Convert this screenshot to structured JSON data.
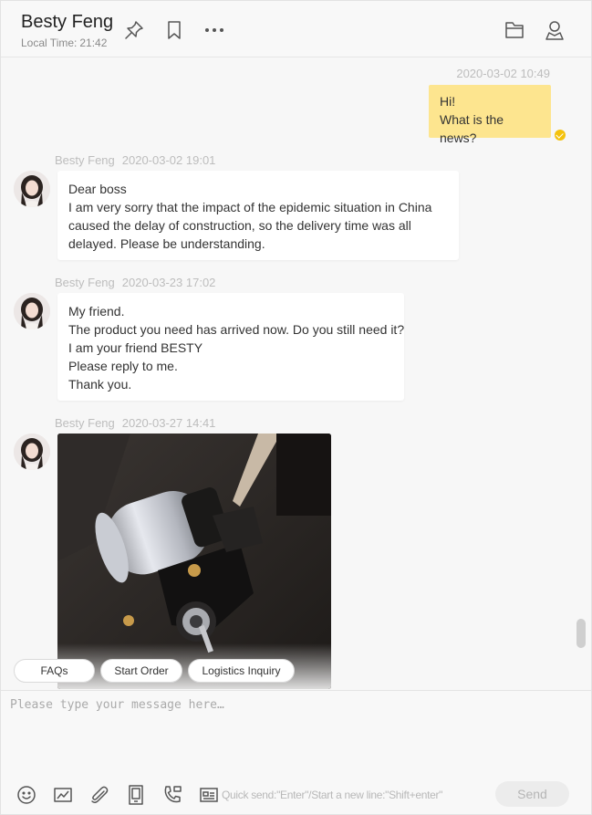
{
  "header": {
    "contact_name": "Besty Feng",
    "local_time_label": "Local Time:",
    "local_time": "21:42",
    "icons": [
      "pin-icon",
      "bookmark-icon",
      "more-icon",
      "folder-icon",
      "contact-profile-icon"
    ]
  },
  "messages": [
    {
      "direction": "out",
      "timestamp": "2020-03-02 10:49",
      "lines": [
        "Hi!",
        "What is the news?"
      ],
      "status": "read"
    },
    {
      "direction": "in",
      "sender": "Besty Feng",
      "timestamp": "2020-03-02 19:01",
      "lines": [
        "Dear boss",
        "I am very sorry that the impact of the epidemic situation in China caused the delay of construction, so the delivery time was all delayed. Please be understanding."
      ]
    },
    {
      "direction": "in",
      "sender": "Besty Feng",
      "timestamp": "2020-03-23 17:02",
      "lines": [
        "My friend.",
        "The product you need has arrived now. Do you still need it?",
        "I am your friend BESTY",
        "Please reply to me.",
        "Thank you."
      ]
    },
    {
      "direction": "in",
      "sender": "Besty Feng",
      "timestamp": "2020-03-27 14:41",
      "type": "image"
    }
  ],
  "quick_actions": [
    "FAQs",
    "Start Order",
    "Logistics Inquiry"
  ],
  "composer": {
    "placeholder": "Please type your message here…",
    "hint": "Quick send:\"Enter\"/Start a new line:\"Shift+enter\"",
    "send_label": "Send",
    "toolbar_icons": [
      "emoji-icon",
      "screenshot-icon",
      "attachment-icon",
      "document-icon",
      "call-icon",
      "business-card-icon"
    ]
  },
  "colors": {
    "outgoing_bubble": "#fde58f",
    "read_indicator": "#f4c20d",
    "incoming_bubble": "#ffffff",
    "background": "#f7f7f7"
  }
}
